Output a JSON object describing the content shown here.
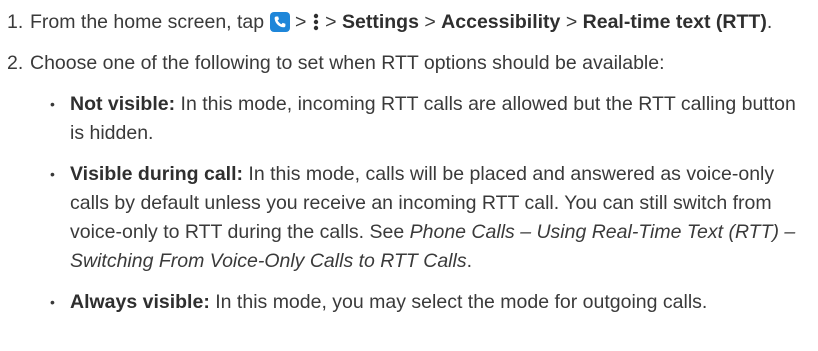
{
  "steps": [
    {
      "number": "1.",
      "text_before_icons": "From the home screen, tap ",
      "sep1": " > ",
      "sep2": " > ",
      "settings": "Settings",
      "sep3": " > ",
      "accessibility": "Accessibility",
      "sep4": " > ",
      "rtt": "Real-time text (RTT)",
      "end": "."
    },
    {
      "number": "2.",
      "text": "Choose one of the following to set when RTT options should be available:"
    }
  ],
  "options": [
    {
      "label": "Not visible:",
      "text": " In this mode, incoming RTT calls are allowed but the RTT calling button is hidden."
    },
    {
      "label": "Visible during call:",
      "text": " In this mode, calls will be placed and answered as voice-only calls by default unless you receive an incoming RTT call. You can still switch from voice-only to RTT during the calls. See ",
      "ref": "Phone Calls – Using Real-Time Text (RTT) – Switching From Voice-Only Calls to RTT Calls",
      "end": "."
    },
    {
      "label": "Always visible:",
      "text": " In this mode, you may select the mode for outgoing calls."
    }
  ],
  "icons": {
    "phone": "phone-icon",
    "menu": "more-options-icon",
    "phone_color": "#1e86d9"
  },
  "colors": {
    "text": "#3a3a3a",
    "bold": "#2f2f2f"
  }
}
